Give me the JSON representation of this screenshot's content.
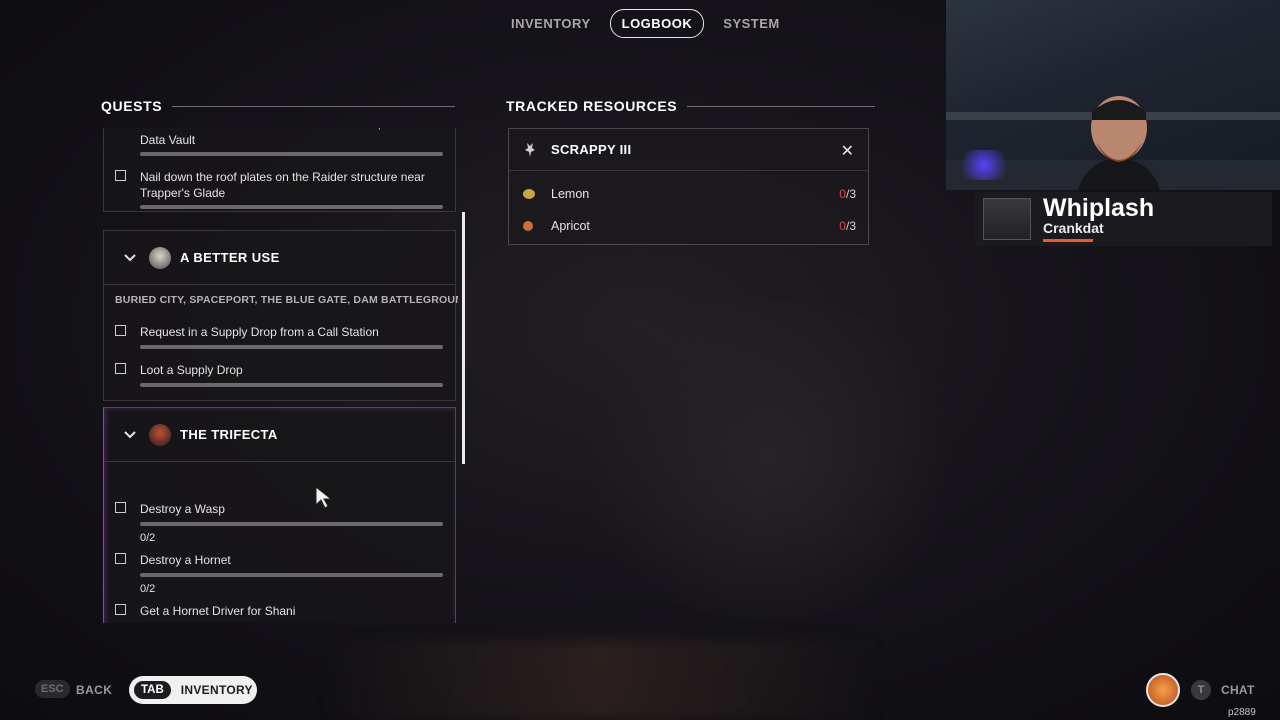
{
  "top_tabs": [
    {
      "label": "INVENTORY",
      "active": false
    },
    {
      "label": "LOGBOOK",
      "active": true
    },
    {
      "label": "SYSTEM",
      "active": false
    }
  ],
  "quests": {
    "title": "QUESTS",
    "partial_task_1": {
      "text": "Rotate the satellite dishes on the church roof, north of the Data Vault"
    },
    "partial_task_2": {
      "text": "Nail down the roof plates on the Raider structure near Trapper's Glade"
    },
    "better_use": {
      "title": "A BETTER USE",
      "locations": "BURIED CITY, SPACEPORT, THE BLUE GATE, DAM BATTLEGROUND",
      "tasks": [
        {
          "text": "Request in a Supply Drop from a Call Station"
        },
        {
          "text": "Loot a Supply Drop"
        }
      ]
    },
    "trifecta": {
      "title": "THE TRIFECTA",
      "tasks": [
        {
          "text": "Destroy a Wasp",
          "count": "0/2"
        },
        {
          "text": "Destroy a Hornet",
          "count": "0/2"
        },
        {
          "text": "Get a Hornet Driver for Shani"
        }
      ]
    }
  },
  "tracked": {
    "title": "TRACKED RESOURCES",
    "item": "SCRAPPY III",
    "close_glyph": "✕",
    "resources": [
      {
        "name": "Lemon",
        "have": "0",
        "need": "/3",
        "color": "#c9a54a"
      },
      {
        "name": "Apricot",
        "have": "0",
        "need": "/3",
        "color": "#c9703a"
      }
    ]
  },
  "streamer": {
    "name": "Whiplash",
    "sub": "Crankdat"
  },
  "bottom": {
    "esc_key": "ESC",
    "back_label": "BACK",
    "tab_key": "TAB",
    "inventory_label": "INVENTORY",
    "t_key": "T",
    "chat_label": "CHAT",
    "build_id": "p2889"
  },
  "colors": {
    "accent_purple": "#9a3cc8",
    "missing_red": "#e2483f",
    "streamer_orange": "#e65c2a"
  },
  "icons": [
    "chevron-down-icon",
    "npc-portrait-icon",
    "rooster-icon",
    "close-icon",
    "lemon-icon",
    "apricot-icon",
    "mouse-cursor-icon"
  ]
}
